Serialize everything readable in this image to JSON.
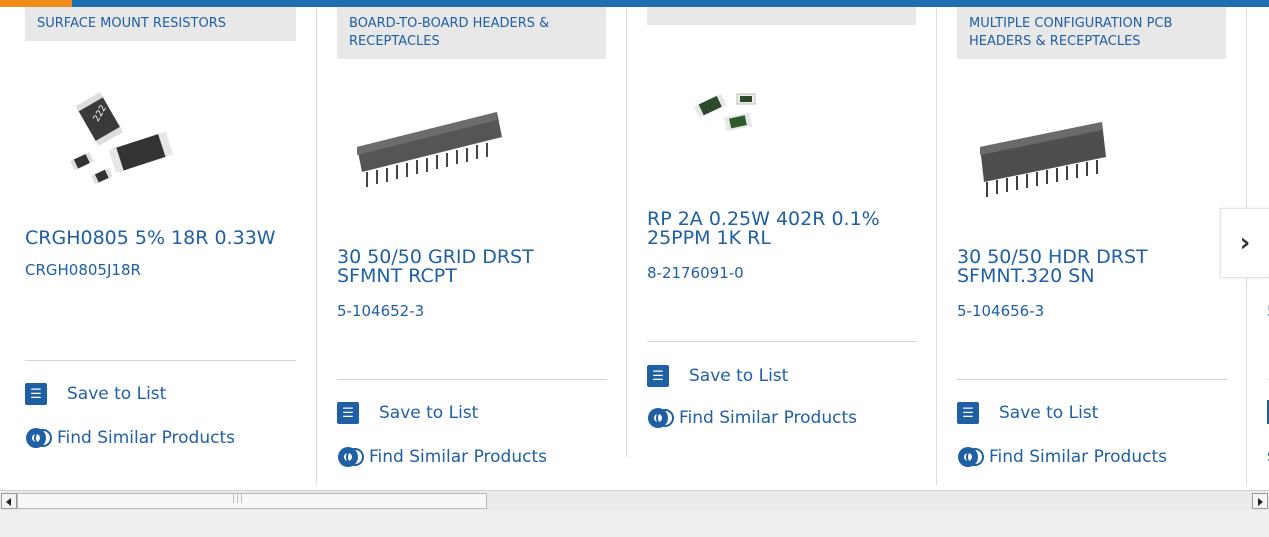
{
  "colors": {
    "accent_blue": "#1f5fa3",
    "bar_blue": "#1e6fb0",
    "bar_orange": "#f08c1a",
    "category_bg": "#e8e8e8"
  },
  "products": [
    {
      "category": "SURFACE MOUNT RESISTORS",
      "title": "CRGH0805 5% 18R 0.33W",
      "part_number": "CRGH0805J18R",
      "save_label": "Save to List",
      "similar_label": "Find Similar Products",
      "image_label": "222"
    },
    {
      "category": "BOARD-TO-BOARD HEADERS & RECEPTACLES",
      "title": "30 50/50 GRID DRST SFMNT RCPT",
      "part_number": "5-104652-3",
      "save_label": "Save to List",
      "similar_label": "Find Similar Products"
    },
    {
      "category": "",
      "title": "RP 2A 0.25W 402R 0.1% 25PPM 1K RL",
      "part_number": "8-2176091-0",
      "save_label": "Save to List",
      "similar_label": "Find Similar Products"
    },
    {
      "category": "MULTIPLE CONFIGURATION PCB HEADERS & RECEPTACLES",
      "title": "30 50/50 HDR DRST SFMNT.320 SN",
      "part_number": "5-104656-3",
      "save_label": "Save to List",
      "similar_label": "Find Similar Products"
    },
    {
      "part_number_fragment": "5",
      "similar_fragment": "s"
    }
  ],
  "carousel": {
    "next_icon": "chevron-right-icon"
  },
  "scrollbar": {
    "left_icon": "arrow-left-icon",
    "right_icon": "arrow-right-icon"
  }
}
